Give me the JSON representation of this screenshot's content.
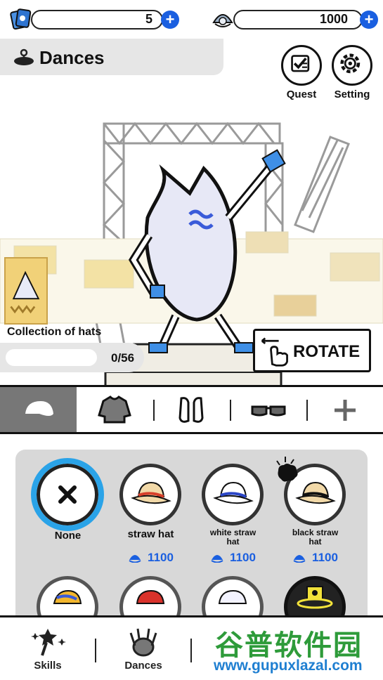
{
  "currency": {
    "tickets": "5",
    "shells": "1000"
  },
  "header": {
    "title": "Dances"
  },
  "buttons": {
    "quest": "Quest",
    "setting": "Setting",
    "rotate": "ROTATE"
  },
  "collection": {
    "label": "Collection of hats",
    "count": "0/56",
    "progress": 0
  },
  "items": [
    {
      "name": "None",
      "price": "",
      "selected": true
    },
    {
      "name": "straw hat",
      "price": "1100"
    },
    {
      "name": "white straw hat",
      "price": "1100"
    },
    {
      "name": "black straw hat",
      "price": "1100"
    }
  ],
  "row2_partial": [
    "yellow-hat",
    "red-cap",
    "white-cap",
    "gold-item"
  ],
  "nav": {
    "skills": "Skills",
    "dances": "Dances"
  },
  "watermark": {
    "cn": "谷普软件园",
    "url": "www.gupuxlazal.com"
  },
  "colors": {
    "accent": "#1a5fe0",
    "selected_ring": "#2aa3e8",
    "tab_active": "#777777"
  }
}
